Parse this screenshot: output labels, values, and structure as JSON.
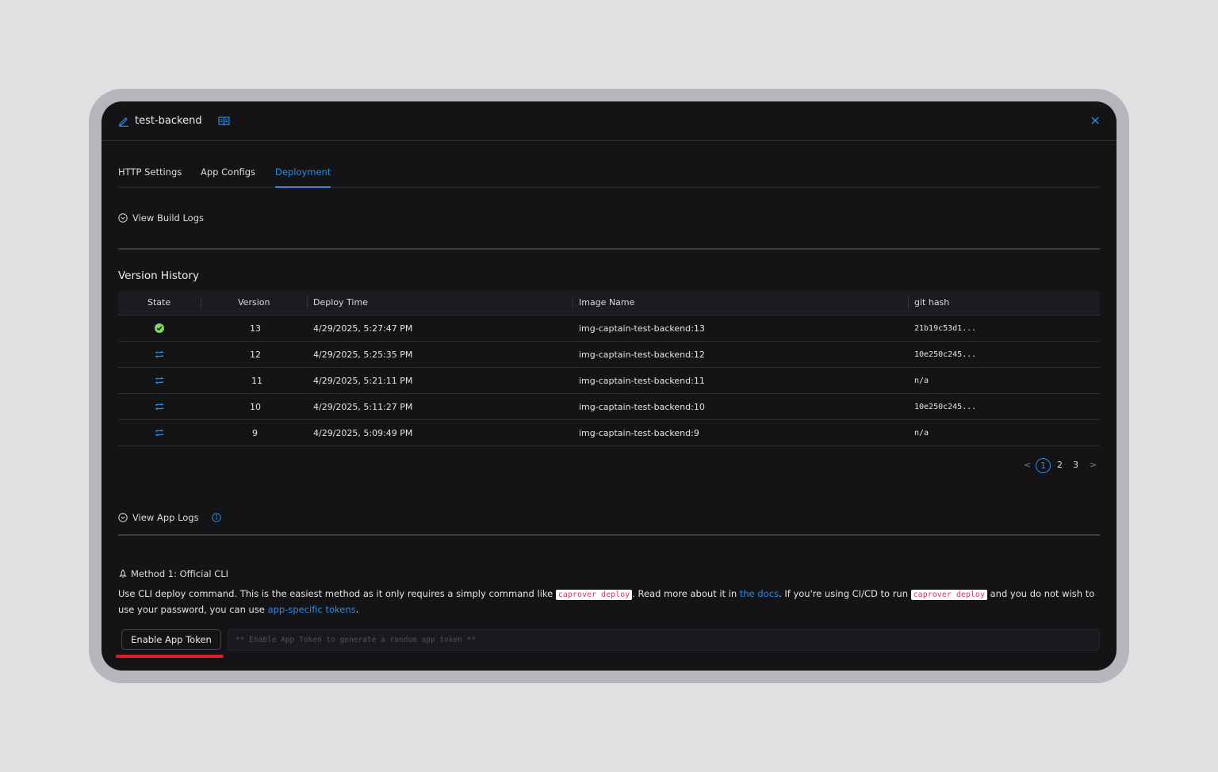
{
  "header": {
    "app_name": "test-backend"
  },
  "tabs": [
    {
      "label": "HTTP Settings",
      "active": false
    },
    {
      "label": "App Configs",
      "active": false
    },
    {
      "label": "Deployment",
      "active": true
    }
  ],
  "build_logs": {
    "label": "View Build Logs"
  },
  "version_history": {
    "title": "Version History",
    "columns": [
      "State",
      "Version",
      "Deploy Time",
      "Image Name",
      "git hash"
    ],
    "rows": [
      {
        "state": "deployed",
        "version": "13",
        "deploy_time": "4/29/2025, 5:27:47 PM",
        "image_name": "img-captain-test-backend:13",
        "git_hash": "21b19c53d1..."
      },
      {
        "state": "rollback",
        "version": "12",
        "deploy_time": "4/29/2025, 5:25:35 PM",
        "image_name": "img-captain-test-backend:12",
        "git_hash": "10e250c245..."
      },
      {
        "state": "rollback",
        "version": "11",
        "deploy_time": "4/29/2025, 5:21:11 PM",
        "image_name": "img-captain-test-backend:11",
        "git_hash": "n/a"
      },
      {
        "state": "rollback",
        "version": "10",
        "deploy_time": "4/29/2025, 5:11:27 PM",
        "image_name": "img-captain-test-backend:10",
        "git_hash": "10e250c245..."
      },
      {
        "state": "rollback",
        "version": "9",
        "deploy_time": "4/29/2025, 5:09:49 PM",
        "image_name": "img-captain-test-backend:9",
        "git_hash": "n/a"
      }
    ],
    "pagination": {
      "prev": "<",
      "pages": [
        "1",
        "2",
        "3"
      ],
      "current": "1",
      "next": ">"
    }
  },
  "app_logs": {
    "label": "View App Logs"
  },
  "method1": {
    "title": "Method 1: Official CLI",
    "desc_1": "Use CLI deploy command. This is the easiest method as it only requires a simply command like ",
    "code_1": "caprover deploy",
    "desc_2": ". Read more about it in ",
    "link_docs": "the docs",
    "desc_3": ". If you're using CI/CD to run ",
    "code_2": "caprover deploy",
    "desc_4": " and you do not wish to use your password, you can use ",
    "link_tokens": "app-specific tokens",
    "desc_5": ".",
    "enable_button": "Enable App Token",
    "token_placeholder": "** Enable App Token to generate a random app token **"
  },
  "colors": {
    "accent": "#2a8ae8",
    "success": "#52c41a",
    "highlight": "#e01b24"
  }
}
